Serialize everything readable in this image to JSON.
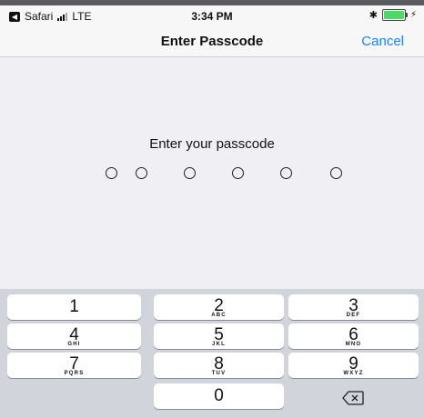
{
  "status_bar": {
    "back_app": "Safari",
    "carrier": "LTE",
    "time": "3:34 PM",
    "bluetooth": "✱",
    "charging": "⚡",
    "icons": [
      "back-arrow-icon",
      "signal-icon",
      "bluetooth-icon",
      "battery-icon",
      "charging-icon"
    ]
  },
  "nav": {
    "title": "Enter Passcode",
    "cancel": "Cancel",
    "accent_color": "#1a82fb"
  },
  "prompt": "Enter your passcode",
  "passcode": {
    "length": 6,
    "entered": 0
  },
  "keypad": {
    "keys": [
      {
        "digit": "1",
        "letters": ""
      },
      {
        "digit": "2",
        "letters": "ABC"
      },
      {
        "digit": "3",
        "letters": "DEF"
      },
      {
        "digit": "4",
        "letters": "GHI"
      },
      {
        "digit": "5",
        "letters": "JKL"
      },
      {
        "digit": "6",
        "letters": "MNO"
      },
      {
        "digit": "7",
        "letters": "PQRS"
      },
      {
        "digit": "8",
        "letters": "TUV"
      },
      {
        "digit": "9",
        "letters": "WXYZ"
      },
      {
        "digit": "0",
        "letters": ""
      }
    ],
    "delete_icon": "backspace-icon"
  }
}
